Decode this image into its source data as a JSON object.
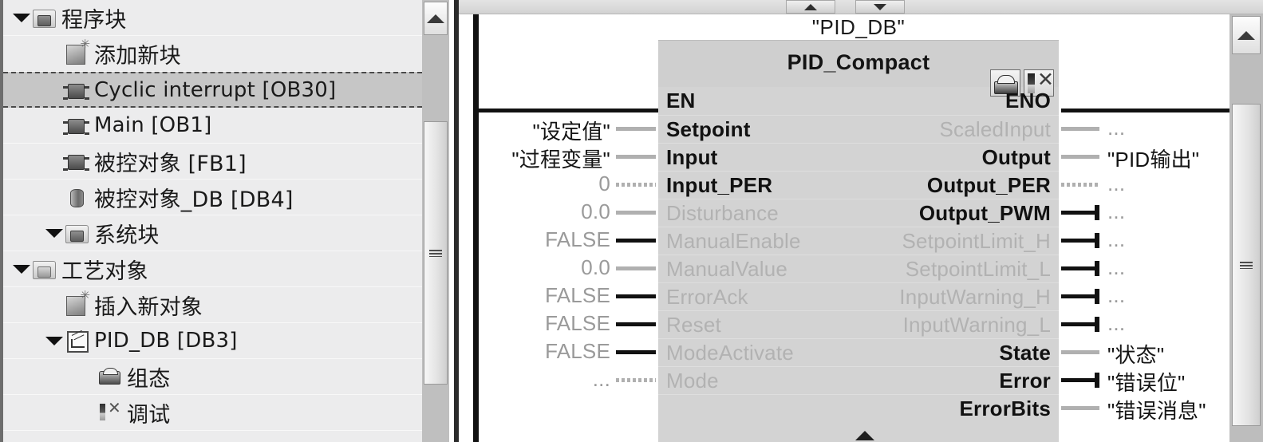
{
  "project_tree": {
    "rows": [
      {
        "label": "程序块",
        "icon": "folder-icon",
        "indent": 0,
        "expanded": true,
        "selected": false,
        "kind": "folder"
      },
      {
        "label": "添加新块",
        "icon": "add-new-block-icon",
        "indent": 1,
        "expanded": null,
        "selected": false,
        "kind": "new"
      },
      {
        "label": "Cyclic interrupt [OB30]",
        "icon": "organization-block-icon",
        "indent": 1,
        "expanded": null,
        "selected": true,
        "kind": "ob"
      },
      {
        "label": "Main [OB1]",
        "icon": "organization-block-icon",
        "indent": 1,
        "expanded": null,
        "selected": false,
        "kind": "ob"
      },
      {
        "label": "被控对象 [FB1]",
        "icon": "function-block-icon",
        "indent": 1,
        "expanded": null,
        "selected": false,
        "kind": "ob"
      },
      {
        "label": "被控对象_DB [DB4]",
        "icon": "data-block-icon",
        "indent": 1,
        "expanded": null,
        "selected": false,
        "kind": "db"
      },
      {
        "label": "系统块",
        "icon": "folder-icon",
        "indent": 1,
        "expanded": true,
        "selected": false,
        "kind": "folder"
      },
      {
        "label": "工艺对象",
        "icon": "technology-objects-folder-icon",
        "indent": 0,
        "expanded": true,
        "selected": false,
        "kind": "techfolder"
      },
      {
        "label": "插入新对象",
        "icon": "add-new-object-icon",
        "indent": 1,
        "expanded": null,
        "selected": false,
        "kind": "new"
      },
      {
        "label": "PID_DB [DB3]",
        "icon": "pid-object-icon",
        "indent": 1,
        "expanded": true,
        "selected": false,
        "kind": "pid"
      },
      {
        "label": "组态",
        "icon": "configuration-icon",
        "indent": 2,
        "expanded": null,
        "selected": false,
        "kind": "cfg"
      },
      {
        "label": "调试",
        "icon": "commissioning-icon",
        "indent": 2,
        "expanded": null,
        "selected": false,
        "kind": "dbg"
      }
    ]
  },
  "editor": {
    "nav_up_icon": "scroll-up-triangle-icon",
    "nav_down_icon": "scroll-down-triangle-icon",
    "bottom_caret_icon": "expand-up-triangle-icon",
    "scroll_up_icon": "chevron-up-icon"
  },
  "function_block": {
    "instance_db": "\"PID_DB\"",
    "type_name": "PID_Compact",
    "tools": [
      {
        "name": "configuration-button",
        "icon": "toolbox-icon"
      },
      {
        "name": "commissioning-button",
        "icon": "screwdriver-pliers-icon"
      }
    ],
    "en_label": "EN",
    "eno_label": "ENO",
    "inputs": [
      {
        "param": "Setpoint",
        "operand": "\"设定值\"",
        "dim_param": false,
        "dim_operand": false,
        "wire": "lite"
      },
      {
        "param": "Input",
        "operand": "\"过程变量\"",
        "dim_param": false,
        "dim_operand": false,
        "wire": "lite"
      },
      {
        "param": "Input_PER",
        "operand": "0",
        "dim_param": false,
        "dim_operand": true,
        "wire": "dot"
      },
      {
        "param": "Disturbance",
        "operand": "0.0",
        "dim_param": true,
        "dim_operand": true,
        "wire": "lite"
      },
      {
        "param": "ManualEnable",
        "operand": "FALSE",
        "dim_param": true,
        "dim_operand": true,
        "wire": "dark"
      },
      {
        "param": "ManualValue",
        "operand": "0.0",
        "dim_param": true,
        "dim_operand": true,
        "wire": "lite"
      },
      {
        "param": "ErrorAck",
        "operand": "FALSE",
        "dim_param": true,
        "dim_operand": true,
        "wire": "dark"
      },
      {
        "param": "Reset",
        "operand": "FALSE",
        "dim_param": true,
        "dim_operand": true,
        "wire": "dark"
      },
      {
        "param": "ModeActivate",
        "operand": "FALSE",
        "dim_param": true,
        "dim_operand": true,
        "wire": "dark"
      },
      {
        "param": "Mode",
        "operand": "...",
        "dim_param": true,
        "dim_operand": true,
        "wire": "dot"
      }
    ],
    "outputs": [
      {
        "param": "ScaledInput",
        "operand": "...",
        "dim_param": true,
        "dim_operand": true,
        "wire": "lite",
        "cap": false
      },
      {
        "param": "Output",
        "operand": "\"PID输出\"",
        "dim_param": false,
        "dim_operand": false,
        "wire": "lite",
        "cap": false
      },
      {
        "param": "Output_PER",
        "operand": "...",
        "dim_param": false,
        "dim_operand": true,
        "wire": "dot",
        "cap": false
      },
      {
        "param": "Output_PWM",
        "operand": "...",
        "dim_param": false,
        "dim_operand": true,
        "wire": "dark",
        "cap": true
      },
      {
        "param": "SetpointLimit_H",
        "operand": "...",
        "dim_param": true,
        "dim_operand": true,
        "wire": "dark",
        "cap": true
      },
      {
        "param": "SetpointLimit_L",
        "operand": "...",
        "dim_param": true,
        "dim_operand": true,
        "wire": "dark",
        "cap": true
      },
      {
        "param": "InputWarning_H",
        "operand": "...",
        "dim_param": true,
        "dim_operand": true,
        "wire": "dark",
        "cap": true
      },
      {
        "param": "InputWarning_L",
        "operand": "...",
        "dim_param": true,
        "dim_operand": true,
        "wire": "dark",
        "cap": true
      },
      {
        "param": "State",
        "operand": "\"状态\"",
        "dim_param": false,
        "dim_operand": false,
        "wire": "lite",
        "cap": false
      },
      {
        "param": "Error",
        "operand": "\"错误位\"",
        "dim_param": false,
        "dim_operand": false,
        "wire": "dark",
        "cap": true
      },
      {
        "param": "ErrorBits",
        "operand": "\"错误消息\"",
        "dim_param": false,
        "dim_operand": false,
        "wire": "lite",
        "cap": false
      }
    ]
  },
  "colors": {
    "panel_bg": "#ececed",
    "selection": "#c6c6c6",
    "block_bg": "#d3d3d3",
    "block_header": "#cfcfcf",
    "dim_text": "#b2b2b2",
    "text": "#141414",
    "rail": "#111111"
  }
}
